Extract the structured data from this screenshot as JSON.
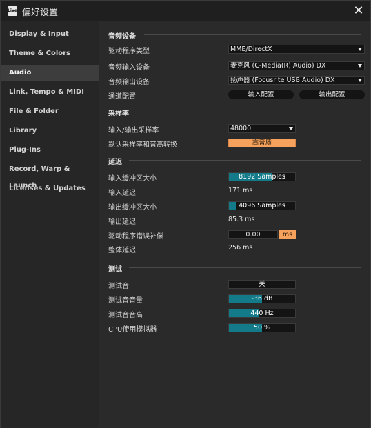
{
  "window": {
    "title": "偏好设置",
    "logo_text": "Live",
    "close_glyph": "✕"
  },
  "sidebar": {
    "items": [
      {
        "label": "Display & Input"
      },
      {
        "label": "Theme & Colors"
      },
      {
        "label": "Audio",
        "active": true
      },
      {
        "label": "Link, Tempo & MIDI"
      },
      {
        "label": "File & Folder"
      },
      {
        "label": "Library"
      },
      {
        "label": "Plug-Ins"
      },
      {
        "label": "Record, Warp & Launch"
      },
      {
        "label": "Licenses & Updates"
      }
    ]
  },
  "audio_device": {
    "title": "音频设备",
    "driver_type_label": "驱动程序类型",
    "driver_type_value": "MME/DirectX",
    "input_device_label": "音频输入设备",
    "input_device_value": "麦克风 (C-Media(R) Audio) DX",
    "output_device_label": "音频输出设备",
    "output_device_value": "扬声器 (Focusrite USB Audio) DX",
    "channel_config_label": "通道配置",
    "input_config_button": "输入配置",
    "output_config_button": "输出配置"
  },
  "sample_rate": {
    "title": "采样率",
    "rate_label": "输入/输出采样率",
    "rate_value": "48000",
    "default_conv_label": "默认采样率和音高转换",
    "default_conv_value": "高音质"
  },
  "latency": {
    "title": "延迟",
    "in_buffer_label": "输入缓冲区大小",
    "in_buffer_value": "8192 Samples",
    "in_buffer_fill": 0.65,
    "in_latency_label": "输入延迟",
    "in_latency_value": "171 ms",
    "out_buffer_label": "输出缓冲区大小",
    "out_buffer_value": "4096 Samples",
    "out_buffer_fill": 0.1,
    "out_latency_label": "输出延迟",
    "out_latency_value": "85.3 ms",
    "driver_comp_label": "驱动程序错误补偿",
    "driver_comp_value": "0.00",
    "driver_comp_unit": "ms",
    "total_latency_label": "整体延迟",
    "total_latency_value": "256 ms"
  },
  "test": {
    "title": "测试",
    "tone_label": "测试音",
    "tone_value": "关",
    "volume_label": "测试音音量",
    "volume_value": "-36 dB",
    "volume_fill": 0.5,
    "freq_label": "测试音音高",
    "freq_value": "440 Hz",
    "freq_fill": 0.45,
    "cpu_label": "CPU使用模拟器",
    "cpu_value": "50 %",
    "cpu_fill": 0.5
  },
  "colors": {
    "accent_teal": "#127a89",
    "accent_orange": "#f6a25d",
    "field_bg": "#141414"
  }
}
